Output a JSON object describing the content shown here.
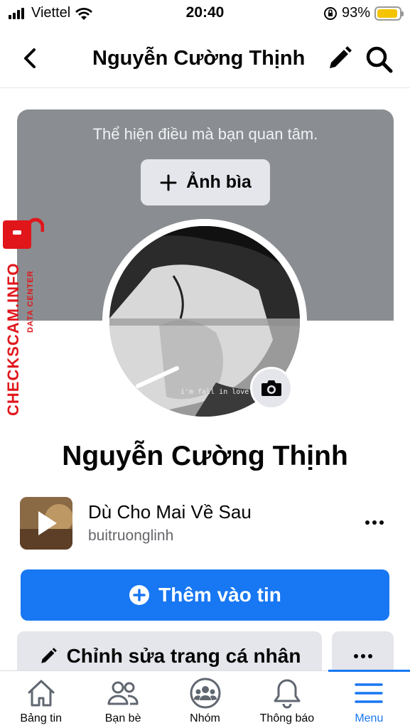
{
  "status_bar": {
    "carrier": "Viettel",
    "time": "20:40",
    "battery_percent": "93%",
    "battery_level": 0.93,
    "icons": [
      "signal-icon",
      "wifi-icon",
      "orientation-lock-icon",
      "battery-icon"
    ]
  },
  "header": {
    "title": "Nguyễn Cường Thịnh",
    "icons": [
      "back-icon",
      "pencil-icon",
      "search-icon"
    ]
  },
  "cover": {
    "hint": "Thể hiện điều mà bạn quan tâm.",
    "button_label": "Ảnh bìa"
  },
  "watermark": {
    "main": "CHECKSCAM.INFO",
    "sub": "DATA CENTER"
  },
  "profile": {
    "name": "Nguyễn Cường Thịnh",
    "avatar_caption": "i'm fall in love with"
  },
  "music": {
    "title": "Dù Cho Mai Về Sau",
    "artist": "buitruonglinh"
  },
  "actions": {
    "add_story": "Thêm vào tin",
    "edit_profile": "Chỉnh sửa trang cá nhân"
  },
  "tabbar": {
    "items": [
      {
        "label": "Bảng tin",
        "icon": "home-icon",
        "active": false
      },
      {
        "label": "Bạn bè",
        "icon": "friends-icon",
        "active": false
      },
      {
        "label": "Nhóm",
        "icon": "groups-icon",
        "active": false
      },
      {
        "label": "Thông báo",
        "icon": "bell-icon",
        "active": false
      },
      {
        "label": "Menu",
        "icon": "menu-icon",
        "active": true
      }
    ]
  },
  "colors": {
    "accent": "#1877f2",
    "cover": "#8a8d91",
    "button_gray": "#e4e6eb",
    "watermark": "#e0161b"
  }
}
